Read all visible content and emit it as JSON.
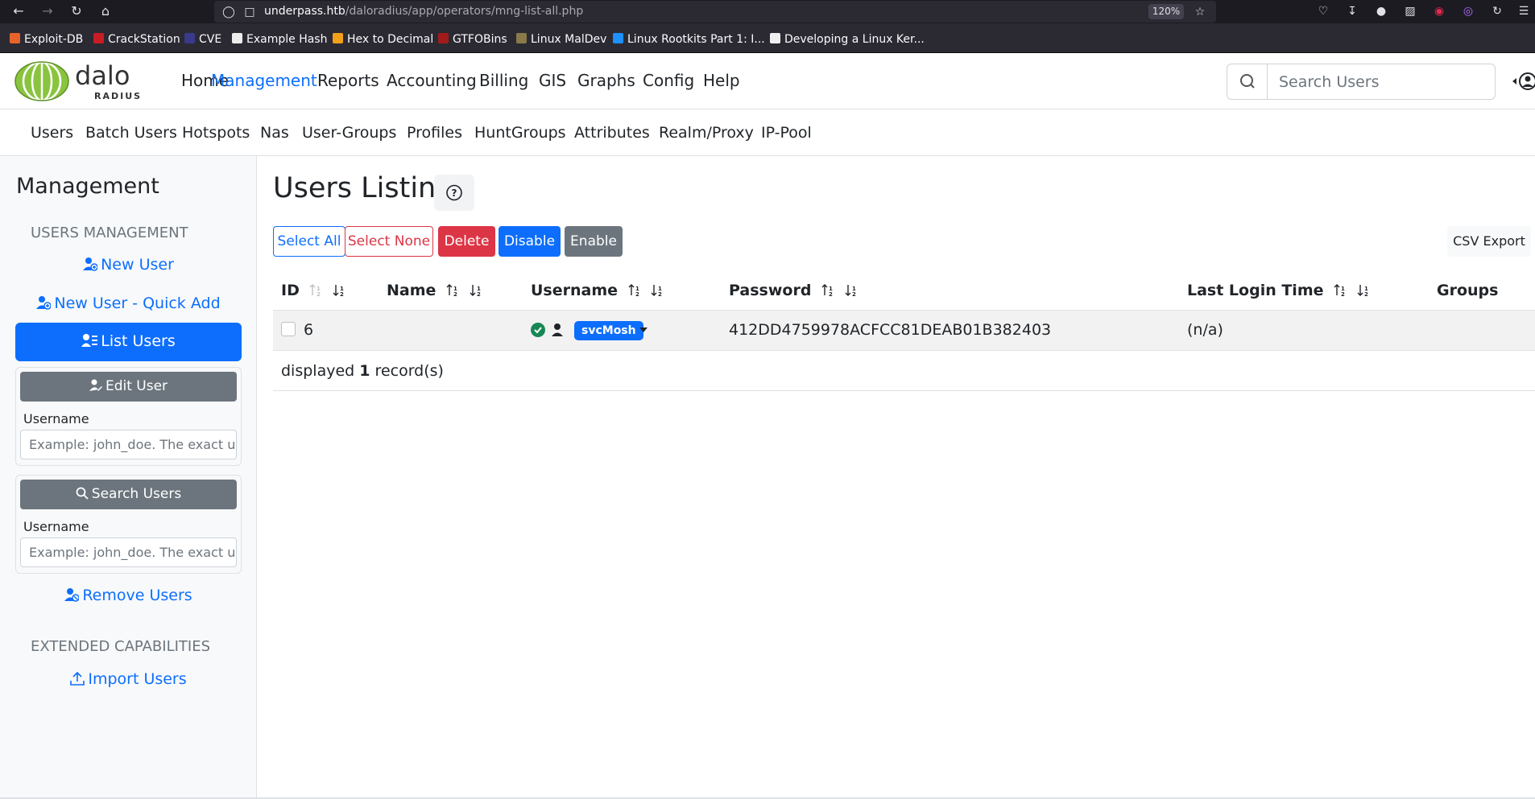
{
  "browser": {
    "url_host": "underpass.htb",
    "url_path": "/daloradius/app/operators/mng-list-all.php",
    "zoom": "120%",
    "bookmarks": [
      "Exploit-DB",
      "CrackStation",
      "CVE",
      "Example Hash",
      "Hex to Decimal",
      "GTFOBins",
      "Linux MalDev",
      "Linux Rootkits Part 1: I...",
      "Developing a Linux Ker..."
    ]
  },
  "app": {
    "logo_text": "dalo",
    "logo_subtext": "RADIUS",
    "nav": [
      "Home",
      "Management",
      "Reports",
      "Accounting",
      "Billing",
      "GIS",
      "Graphs",
      "Config",
      "Help"
    ],
    "active_nav": "Management",
    "search_placeholder": "Search Users",
    "subnav": [
      "Users",
      "Batch Users",
      "Hotspots",
      "Nas",
      "User-Groups",
      "Profiles",
      "HuntGroups",
      "Attributes",
      "Realm/Proxy",
      "IP-Pool"
    ]
  },
  "sidebar": {
    "title": "Management",
    "section_users": "USERS MANAGEMENT",
    "new_user": "New User",
    "new_user_quick": "New User - Quick Add",
    "list_users": "List Users",
    "edit_user": "Edit User",
    "edit_label": "Username",
    "edit_placeholder": "Example: john_doe. The exact username",
    "search_users": "Search Users",
    "search_label": "Username",
    "search_placeholder": "Example: john_doe. The exact username",
    "remove_users": "Remove Users",
    "section_ext": "EXTENDED CAPABILITIES",
    "import_users": "Import Users"
  },
  "main": {
    "title": "Users Listing",
    "actions": {
      "select_all": "Select All",
      "select_none": "Select None",
      "delete": "Delete",
      "disable": "Disable",
      "enable": "Enable",
      "csv_export": "CSV Export"
    },
    "columns": [
      "ID",
      "Name",
      "Username",
      "Password",
      "Last Login Time",
      "Groups"
    ],
    "rows": [
      {
        "id": "6",
        "name": "",
        "username": "svcMosh",
        "password": "412DD4759978ACFCC81DEAB01B382403",
        "last_login": "(n/a)",
        "groups": ""
      }
    ],
    "footer_prefix": "displayed",
    "footer_count": "1",
    "footer_suffix": "record(s)"
  },
  "colors": {
    "primary": "#0d6efd",
    "danger": "#dc3545",
    "secondary": "#6c757d",
    "success": "#198754",
    "logo_green": "#8ac43f"
  }
}
